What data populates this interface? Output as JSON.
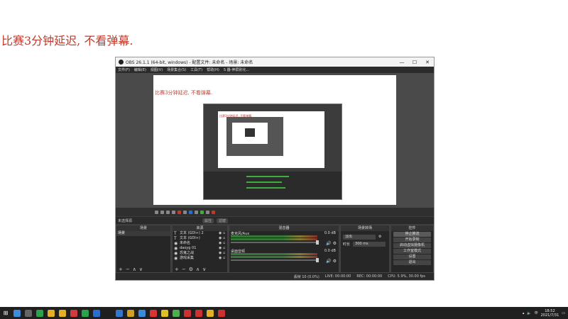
{
  "banner": {
    "text": "比赛3分钟延迟, 不看弹幕."
  },
  "window": {
    "title": "OBS 26.1.1 (64-bit, windows) - 配置文件: 未命名 - 场景: 未命名",
    "controls": {
      "minimize": "—",
      "maximize": "☐",
      "close": "✕"
    },
    "menu": [
      "文件(F)",
      "编辑(E)",
      "视图(V)",
      "场景集合(S)",
      "工具(T)",
      "帮助(H)",
      "S 器-伸屏别化..."
    ]
  },
  "preview": {
    "text": "比赛3分钟延迟, 不看弹幕.",
    "nested_text": "比赛3分钟延迟, 不看弹幕."
  },
  "context": {
    "label": "未选择源",
    "props": "属性",
    "filters": "滤镜"
  },
  "scenes": {
    "header": "场景",
    "items": [
      "场景"
    ]
  },
  "sources": {
    "header": "来源",
    "items": [
      {
        "icon": "T",
        "name": "文本 (GDI+) 2"
      },
      {
        "icon": "T",
        "name": "文本 (GDI+)"
      },
      {
        "icon": "◉",
        "name": "未命名"
      },
      {
        "icon": "◉",
        "name": "daoyg 01"
      },
      {
        "icon": "◉",
        "name": "恐鬼之战"
      },
      {
        "icon": "◉",
        "name": "游戏采集"
      }
    ]
  },
  "mixer": {
    "header": "混音器",
    "tracks": [
      {
        "name": "麦克风/Aux",
        "db": "0.0 dB"
      },
      {
        "name": "桌面音频",
        "db": "0.0 dB"
      }
    ]
  },
  "transitions": {
    "header": "场景转场",
    "type": "淡出",
    "duration_label": "时长",
    "duration": "300 ms"
  },
  "controls": {
    "header": "控件",
    "buttons": [
      "停止推流",
      "开始录制",
      "启动虚拟摄像机",
      "工作室模式",
      "设置",
      "退出"
    ]
  },
  "statusbar": {
    "live": "LIVE: 00:00:00",
    "rec": "REC: 00:00:00",
    "cpu": "CPU: 5.9%, 30.00 fps",
    "dropped": "丢帧 10 (0.0%)"
  },
  "taskbar": {
    "time": "18:52",
    "date": "2021/7/31",
    "lang": "中",
    "icons": [
      "#3d8bd9",
      "#666",
      "#2aa34a",
      "#e3b022",
      "#e3b022",
      "#d23b3b",
      "#2aa34a",
      "#2a6fd0",
      "#1f1f1f",
      "#3477d0",
      "#d0a020",
      "#3a8ad9",
      "#d33",
      "#e0c020",
      "#4cae4c",
      "#d03030",
      "#d03030",
      "#e3b022",
      "#d03030"
    ]
  }
}
